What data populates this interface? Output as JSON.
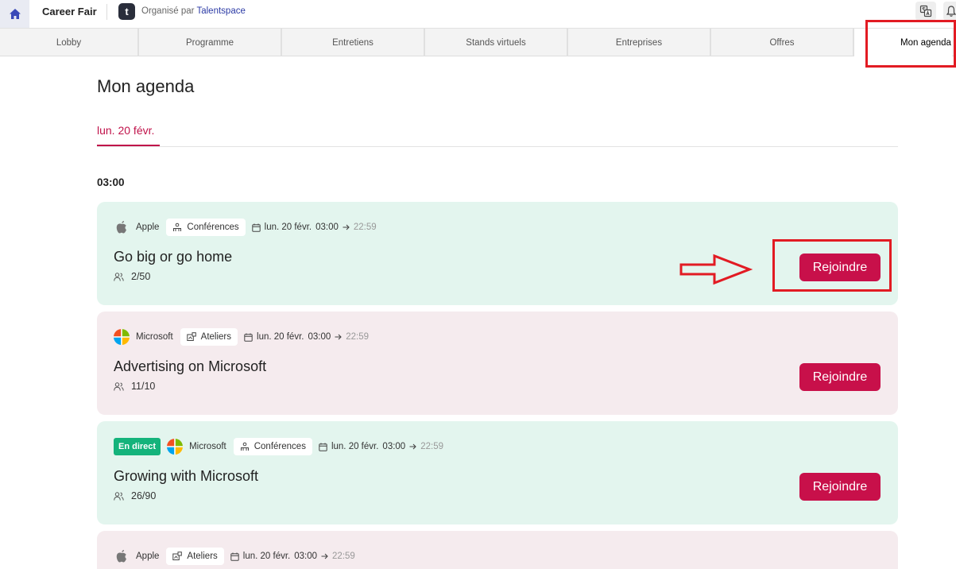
{
  "topbar": {
    "app_title": "Career Fair",
    "org_logo_letter": "t",
    "organised_by": "Organisé par",
    "org_name": "Talentspace",
    "icons": [
      "home-icon",
      "translate-icon",
      "bell-icon"
    ]
  },
  "nav": {
    "tabs": [
      {
        "label": "Lobby"
      },
      {
        "label": "Programme"
      },
      {
        "label": "Entretiens"
      },
      {
        "label": "Stands virtuels"
      },
      {
        "label": "Entreprises"
      },
      {
        "label": "Offres"
      },
      {
        "label": "Mon agenda",
        "active": true
      }
    ]
  },
  "main": {
    "title": "Mon agenda",
    "date_tab": "lun. 20 févr.",
    "time_heading": "03:00",
    "join_label": "Rejoindre",
    "sessions": [
      {
        "company": "Apple",
        "category": "Conférences",
        "date": "lun. 20 févr.",
        "start": "03:00",
        "end": "22:59",
        "title": "Go big or go home",
        "participants": "2/50",
        "live": "",
        "bg": "#e3f5ee"
      },
      {
        "company": "Microsoft",
        "category": "Ateliers",
        "date": "lun. 20 févr.",
        "start": "03:00",
        "end": "22:59",
        "title": "Advertising on Microsoft",
        "participants": "11/10",
        "live": "",
        "bg": "#f5ebee"
      },
      {
        "company": "Microsoft",
        "category": "Conférences",
        "date": "lun. 20 févr.",
        "start": "03:00",
        "end": "22:59",
        "title": "Growing with Microsoft",
        "participants": "26/90",
        "live": "En direct",
        "bg": "#e3f5ee"
      },
      {
        "company": "Apple",
        "category": "Ateliers",
        "date": "lun. 20 févr.",
        "start": "03:00",
        "end": "22:59",
        "title": "",
        "participants": "",
        "live": "",
        "bg": "#f5ebee"
      }
    ]
  },
  "colors": {
    "accent": "#c8104a",
    "live_badge": "#14b37b",
    "annotation_red": "#e21b23"
  }
}
